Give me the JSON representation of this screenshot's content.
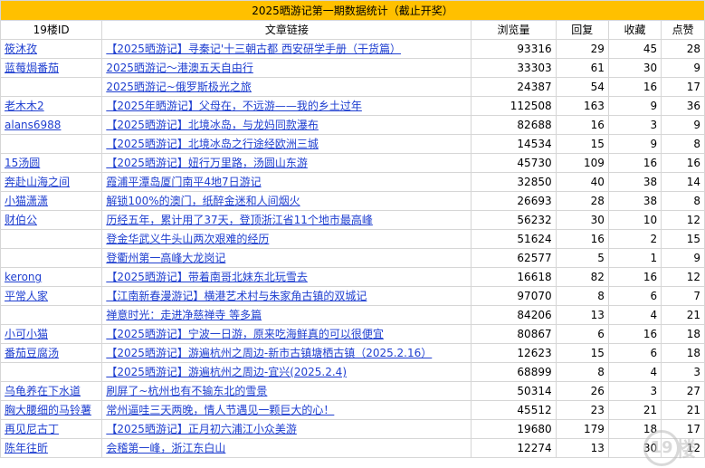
{
  "title": "2025晒游记第一期数据统计（截止开奖）",
  "columns": [
    "19楼ID",
    "文章链接",
    "浏览量",
    "回复",
    "收藏",
    "点赞"
  ],
  "rows": [
    {
      "user": "筱沐孜",
      "link": "【2025晒游记】寻秦记'十三朝古都 西安研学手册（干货篇）",
      "views": "93316",
      "reply": "29",
      "fav": "45",
      "like": "28"
    },
    {
      "user": "蓝莓焗番茄",
      "link": "2025晒游记～港澳五天自由行",
      "views": "33303",
      "reply": "61",
      "fav": "30",
      "like": "9"
    },
    {
      "user": "",
      "link": "2025晒游记~俄罗斯极光之旅",
      "views": "24387",
      "reply": "54",
      "fav": "16",
      "like": "17"
    },
    {
      "user": "老木木2",
      "link": "【2025年晒游记】父母在，不远游——我的乡土过年",
      "views": "112508",
      "reply": "163",
      "fav": "9",
      "like": "36"
    },
    {
      "user": "alans6988",
      "link": "【2025晒游记】北境冰岛，与龙妈同款瀑布",
      "views": "82688",
      "reply": "16",
      "fav": "3",
      "like": "9"
    },
    {
      "user": "",
      "link": "【2025晒游记】北境冰岛之行途经欧洲三城",
      "views": "14534",
      "reply": "15",
      "fav": "9",
      "like": "8"
    },
    {
      "user": "15汤圆",
      "link": "【2025晒游记】妞行万里路，汤圆山东游",
      "views": "45730",
      "reply": "109",
      "fav": "16",
      "like": "16"
    },
    {
      "user": "奔赴山海之间",
      "link": "霞浦平潭岛厦门南平4地7日游记",
      "views": "32850",
      "reply": "40",
      "fav": "38",
      "like": "14"
    },
    {
      "user": "小猫潇潇",
      "link": "解锁100%的澳门，纸醉金迷和人间烟火",
      "views": "26693",
      "reply": "28",
      "fav": "38",
      "like": "8"
    },
    {
      "user": "财伯公",
      "link": "历经五年，累计用了37天，登顶浙江省11个地市最高峰",
      "views": "56232",
      "reply": "30",
      "fav": "10",
      "like": "12"
    },
    {
      "user": "",
      "link": "登金华武义牛头山两次艰难的经历",
      "views": "51624",
      "reply": "16",
      "fav": "2",
      "like": "15"
    },
    {
      "user": "",
      "link": "登衢州第一高峰大龙岗记",
      "views": "62577",
      "reply": "5",
      "fav": "1",
      "like": "9"
    },
    {
      "user": "kerong",
      "link": "【2025晒游记】带着南哥北妹东北玩雪去",
      "views": "16618",
      "reply": "82",
      "fav": "16",
      "like": "12"
    },
    {
      "user": "平常人家",
      "link": "【江南新春漫游记】横港艺术村与朱家角古镇的双城记",
      "views": "97070",
      "reply": "8",
      "fav": "6",
      "like": "7"
    },
    {
      "user": "",
      "link": "禅意时光：走进净慈禅寺 等多篇",
      "views": "84206",
      "reply": "13",
      "fav": "4",
      "like": "21"
    },
    {
      "user": "小可小猫",
      "link": "【2025晒游记】宁波一日游，原来吃海鲜真的可以很便宜",
      "views": "80867",
      "reply": "6",
      "fav": "16",
      "like": "18"
    },
    {
      "user": "番茄豆腐汤",
      "link": "【2025晒游记】游遍杭州之周边-新市古镇塘栖古镇（2025.2.16）",
      "views": "12623",
      "reply": "15",
      "fav": "6",
      "like": "18"
    },
    {
      "user": "",
      "link": "【2025晒游记】游遍杭州之周边-宜兴(2025.2.4)",
      "views": "68899",
      "reply": "8",
      "fav": "4",
      "like": "3"
    },
    {
      "user": "乌龟养在下水道",
      "link": "刷屏了~杭州也有不输东北的雪景",
      "views": "50314",
      "reply": "26",
      "fav": "3",
      "like": "27"
    },
    {
      "user": "胸大腰细的马铃薯",
      "link": "常州逼哇三天两晚，情人节遇见一颗巨大的心！",
      "views": "45512",
      "reply": "23",
      "fav": "21",
      "like": "21"
    },
    {
      "user": "再见尼古丁",
      "link": "【2025晒游记】正月初六浦江小众美游",
      "views": "19680",
      "reply": "179",
      "fav": "18",
      "like": "17"
    },
    {
      "user": "陈年往昕",
      "link": "会稽第一峰，浙江东白山",
      "views": "12274",
      "reply": "13",
      "fav": "30",
      "like": "12"
    }
  ],
  "watermark": {
    "glyph": "19",
    "text": "楼"
  }
}
